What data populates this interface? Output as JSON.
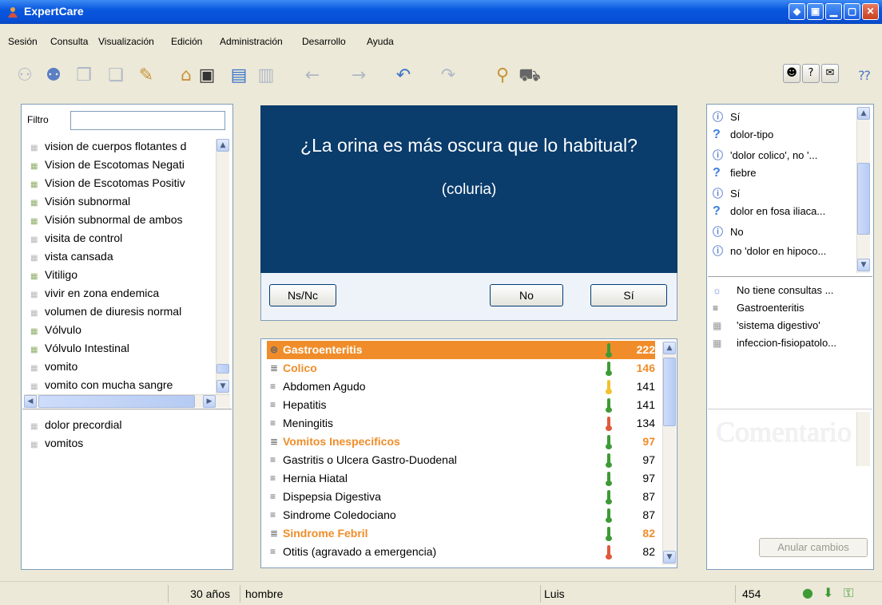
{
  "window": {
    "title": "ExpertCare",
    "buttons": [
      "◆",
      "▣",
      "▁",
      "▢",
      "✕"
    ]
  },
  "menu": [
    "Sesión",
    "Consulta",
    "Visualización",
    "Edición",
    "Administración",
    "Desarrollo",
    "Ayuda"
  ],
  "toolbar": {
    "icons": [
      "new-session-icon",
      "users-icon",
      "book-icon",
      "book-open-icon",
      "undo-book-icon",
      "home-icon",
      "save-icon",
      "card-icon",
      "card-list-icon",
      "back-arrow-icon",
      "forward-arrow-icon",
      "undo-icon",
      "redo-icon",
      "search-magnifier-icon",
      "ambulance-icon"
    ],
    "right_icons": [
      "face-icon",
      "question-icon",
      "note-icon",
      "help-cursor-icon"
    ]
  },
  "left": {
    "filter_label": "Filtro",
    "filter_value": "",
    "items": [
      {
        "label": "vision de cuerpos flotantes d",
        "tree": false
      },
      {
        "label": "Vision de Escotomas Negati",
        "tree": true
      },
      {
        "label": "Vision de Escotomas Positiv",
        "tree": true
      },
      {
        "label": "Visión subnormal",
        "tree": true
      },
      {
        "label": "Visión subnormal de ambos",
        "tree": true
      },
      {
        "label": "visita de control",
        "tree": false
      },
      {
        "label": "vista cansada",
        "tree": false
      },
      {
        "label": "Vitiligo",
        "tree": true
      },
      {
        "label": "vivir en zona endemica",
        "tree": false
      },
      {
        "label": "volumen de diuresis normal",
        "tree": false
      },
      {
        "label": "Vólvulo",
        "tree": true
      },
      {
        "label": "Vólvulo Intestinal",
        "tree": true
      },
      {
        "label": "vomito",
        "tree": false
      },
      {
        "label": "vomito con mucha sangre",
        "tree": false
      }
    ],
    "selected": [
      "dolor precordial",
      "vomitos"
    ]
  },
  "question": {
    "text": "¿La orina es más oscura que lo habitual?",
    "subtext": "(coluria)",
    "answers": [
      "Ns/Nc",
      "No",
      "Sí"
    ]
  },
  "diagnoses": [
    {
      "name": "Gastroenteritis",
      "score": "222",
      "level": "g",
      "style": "sel"
    },
    {
      "name": "Colico",
      "score": "146",
      "level": "g",
      "style": "hl"
    },
    {
      "name": "Abdomen Agudo",
      "score": "141",
      "level": "y",
      "style": ""
    },
    {
      "name": "Hepatitis",
      "score": "141",
      "level": "g",
      "style": ""
    },
    {
      "name": "Meningitis",
      "score": "134",
      "level": "r",
      "style": ""
    },
    {
      "name": "Vomitos Inespecificos",
      "score": "97",
      "level": "g",
      "style": "hl"
    },
    {
      "name": "Gastritis o Ulcera Gastro-Duodenal",
      "score": "97",
      "level": "g",
      "style": ""
    },
    {
      "name": "Hernia Hiatal",
      "score": "97",
      "level": "g",
      "style": ""
    },
    {
      "name": "Dispepsia Digestiva",
      "score": "87",
      "level": "g",
      "style": ""
    },
    {
      "name": "Sindrome Coledociano",
      "score": "87",
      "level": "g",
      "style": ""
    },
    {
      "name": "Sindrome Febril",
      "score": "82",
      "level": "g",
      "style": "hl"
    },
    {
      "name": "Otitis (agravado a emergencia)",
      "score": "82",
      "level": "r",
      "style": ""
    }
  ],
  "history": [
    {
      "type": "ex",
      "text": "Sí"
    },
    {
      "type": "q",
      "text": "dolor-tipo"
    },
    {
      "type": "ex",
      "text": "'dolor colico', no '..."
    },
    {
      "type": "q",
      "text": "fiebre"
    },
    {
      "type": "ex",
      "text": "Sí"
    },
    {
      "type": "q",
      "text": "dolor en fosa iliaca..."
    },
    {
      "type": "ex",
      "text": "No"
    },
    {
      "type": "ex",
      "text": "no 'dolor en hipoco..."
    }
  ],
  "context": [
    "No tiene consultas ...",
    "Gastroenteritis",
    "'sistema digestivo'",
    "infeccion-fisiopatolo..."
  ],
  "comment_placeholder": "Comentario",
  "undo_label": "Anular cambios",
  "status": {
    "age": "30 años",
    "sex": "hombre",
    "user": "Luis",
    "count": "454"
  }
}
